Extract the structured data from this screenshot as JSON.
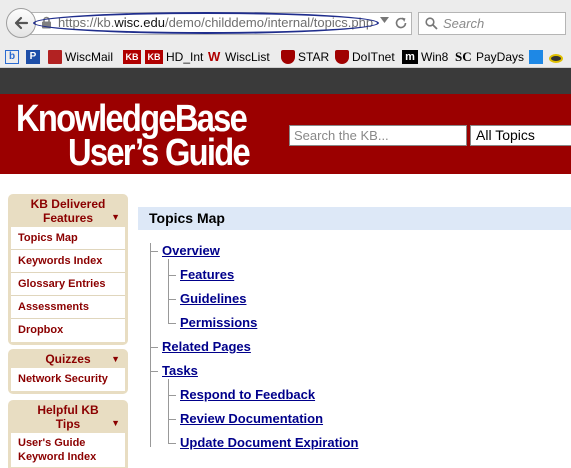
{
  "browser": {
    "url_prefix": "https://kb.",
    "url_domain": "wisc.edu",
    "url_path": "/demo/childdemo/internal/topics.php",
    "search_placeholder": "Search",
    "bookmarks": [
      {
        "label": "",
        "icon": "b-square-icon",
        "color": "#2a6bd1"
      },
      {
        "label": "",
        "icon": "p-square-icon",
        "color": "#1e4fa8"
      },
      {
        "label": "WiscMail",
        "icon": "mail-icon",
        "color": "#b22222"
      },
      {
        "label": "",
        "icon": "kb-logo-icon",
        "color": "#b00000"
      },
      {
        "label": "HD_Int",
        "icon": "kb-logo-icon",
        "color": "#b00000"
      },
      {
        "label": "WiscList",
        "icon": "w-logo-icon",
        "color": "#b00000"
      },
      {
        "label": "STAR",
        "icon": "uw-crest-icon",
        "color": "#a00000"
      },
      {
        "label": "DoITnet",
        "icon": "uw-crest-icon",
        "color": "#a00000"
      },
      {
        "label": "Win8",
        "icon": "m-logo-icon",
        "color": "#000000"
      },
      {
        "label": "PayDays",
        "icon": "sc-logo-icon",
        "color": "#000000"
      },
      {
        "label": "",
        "icon": "sync-icon",
        "color": "#1e88e5"
      },
      {
        "label": "",
        "icon": "eye-icon",
        "color": "#333333"
      }
    ]
  },
  "banner": {
    "logo_line1": "KnowledgeBase",
    "logo_line2": "User’s Guide",
    "search_placeholder": "Search the KB...",
    "topics_select": "All Topics"
  },
  "sidebar": {
    "delivered": {
      "title": "KB Delivered Features",
      "items": [
        "Topics Map",
        "Keywords Index",
        "Glossary Entries",
        "Assessments",
        "Dropbox"
      ]
    },
    "quizzes": {
      "title": "Quizzes",
      "items": [
        "Network Security"
      ]
    },
    "tips": {
      "title": "Helpful KB Tips",
      "items": [
        "User's Guide Keyword Index"
      ]
    }
  },
  "main": {
    "title": "Topics Map",
    "tree": [
      {
        "label": "Overview",
        "level": 0
      },
      {
        "label": "Features",
        "level": 1
      },
      {
        "label": "Guidelines",
        "level": 1
      },
      {
        "label": "Permissions",
        "level": 1
      },
      {
        "label": "Related Pages",
        "level": 0
      },
      {
        "label": "Tasks",
        "level": 0
      },
      {
        "label": "Respond to Feedback",
        "level": 1
      },
      {
        "label": "Review Documentation",
        "level": 1
      },
      {
        "label": "Update Document Expiration",
        "level": 1
      }
    ]
  },
  "colors": {
    "banner": "#9b0000",
    "sidebar_box": "#e8ddc2",
    "link": "#00008b",
    "header_band": "#dde8f7"
  }
}
